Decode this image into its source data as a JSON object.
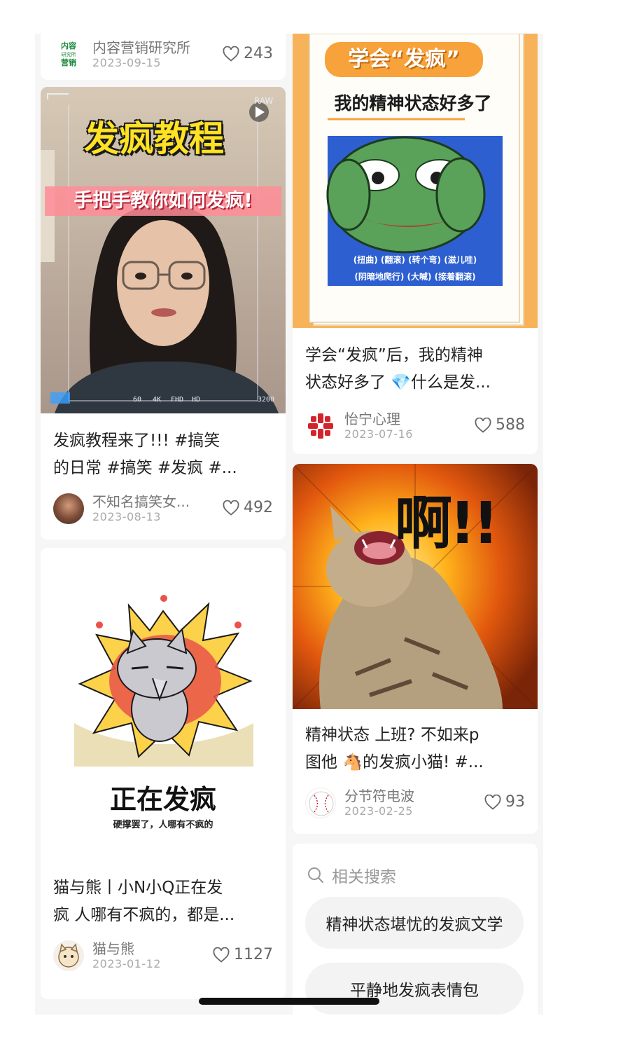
{
  "cards": {
    "a": {
      "author": "内容营销研究所",
      "date": "2023-09-15",
      "likes": "243",
      "avatar_text": [
        "内容",
        "研究所",
        "营销"
      ]
    },
    "b": {
      "cover_title": "发疯教程",
      "cover_subtitle": "手把手教你如何发疯!",
      "cover_raw": "RAW",
      "cover_badges": [
        "60",
        "4K",
        "FHD",
        "HD"
      ],
      "cover_iso": "3200",
      "title_line1": "发疯教程来了!!!  #搞笑",
      "title_line2": "的日常  #搞笑  #发疯  #...",
      "author": "不知名搞笑女...",
      "date": "2023-08-13",
      "likes": "492"
    },
    "c": {
      "cover_heading": "正在发疯",
      "cover_caption": "硬撑罢了，人哪有不疯的",
      "title_line1": "猫与熊丨小N小Q正在发",
      "title_line2": "疯 人哪有不疯的，都是...",
      "author": "猫与熊",
      "date": "2023-01-12",
      "likes": "1127"
    },
    "d": {
      "cover_badge": "学会“发疯”",
      "cover_subtitle": "我的精神状态好多了",
      "cover_caption_1": "(扭曲) (翻滚) (转个弯) (滋儿哇)",
      "cover_caption_2": "(阴暗地爬行) (大喊) (接着翻滚)",
      "title_line1": "学会“发疯”后，我的精神",
      "title_line2": "状态好多了 💎什么是发...",
      "author": "怡宁心理",
      "date": "2023-07-16",
      "likes": "588"
    },
    "e": {
      "cover_shout": "啊!!",
      "title_line1": "精神状态 上班?  不如来p",
      "title_line2": "图他 🐴的发疯小猫!  #...",
      "author": "分节符电波",
      "date": "2023-02-25",
      "likes": "93"
    }
  },
  "related": {
    "header": "相关搜索",
    "chips": [
      "精神状态堪忧的发疯文学",
      "平静地发疯表情包"
    ]
  },
  "icons": {
    "like": "heart-outline-icon",
    "search": "search-icon"
  },
  "colors": {
    "accent_orange": "#f7a23b",
    "like_gray": "#666666"
  }
}
